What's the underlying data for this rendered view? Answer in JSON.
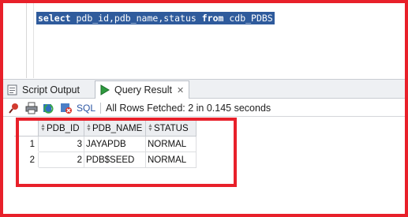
{
  "editor": {
    "sql": {
      "kw_select": "select",
      "columns": " pdb_id,pdb_name,status ",
      "kw_from": "from",
      "table": " cdb_PDBS"
    }
  },
  "tabs": [
    {
      "label": "Script Output",
      "icon": "script-output-icon",
      "active": false
    },
    {
      "label": "Query Result",
      "icon": "query-result-icon",
      "active": true
    }
  ],
  "toolbar": {
    "icons": [
      "pin-icon",
      "print-icon",
      "refresh-icon",
      "cancel-icon"
    ],
    "sql_label": "SQL",
    "separator": "|",
    "fetch_status": "All Rows Fetched: 2 in 0.145 seconds"
  },
  "results": {
    "columns": [
      "PDB_ID",
      "PDB_NAME",
      "STATUS"
    ],
    "rows": [
      {
        "num": "1",
        "pdb_id": "3",
        "pdb_name": "JAYAPDB",
        "status": "NORMAL"
      },
      {
        "num": "2",
        "pdb_id": "2",
        "pdb_name": "PDB$SEED",
        "status": "NORMAL"
      }
    ]
  },
  "colors": {
    "highlight_border": "#e8202a",
    "selection_bg": "#2f5b9c",
    "sql_link": "#2b55a3"
  }
}
